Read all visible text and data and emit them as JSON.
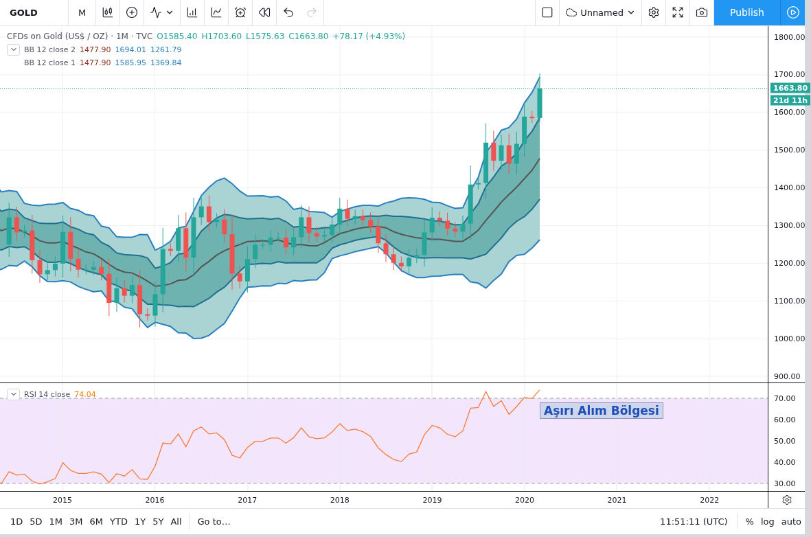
{
  "toolbar": {
    "symbol": "GOLD",
    "interval": "M",
    "redo": {
      "disabled": true
    },
    "layout_name": "Unnamed",
    "publish": "Publish"
  },
  "legend": {
    "title": "CFDs on Gold (US$ / OZ) · 1M · TVC",
    "ohlc": [
      "O1585.40",
      "H1703.60",
      "L1575.63",
      "C1663.80",
      "+78.17 (+4.93%)"
    ],
    "indicators": [
      {
        "label": "BB 12 close 2",
        "values": [
          "1477.90",
          "1694.01",
          "1261.79"
        ],
        "collapse_button": true
      },
      {
        "label": "BB 12 close 1",
        "values": [
          "1477.90",
          "1585.95",
          "1369.84"
        ],
        "collapse_button": false
      }
    ]
  },
  "price_axis": {
    "labels": [
      "1800.00",
      "1700.00",
      "1600.00",
      "1500.00",
      "1400.00",
      "1300.00",
      "1200.00",
      "1100.00",
      "1000.00",
      "900.00"
    ],
    "last_price": "1663.80",
    "countdown": "21d 11h"
  },
  "rsi": {
    "label": "RSI 14 close",
    "value": "74.04",
    "annotation": "Aşırı Alım Bölgesi",
    "axis_labels": [
      "70.00",
      "60.00",
      "50.00",
      "40.00",
      "30.00"
    ]
  },
  "time_axis": [
    "2015",
    "2016",
    "2017",
    "2018",
    "2019",
    "2020",
    "2021",
    "2022"
  ],
  "bottom_bar": {
    "ranges": [
      "1D",
      "5D",
      "1M",
      "3M",
      "6M",
      "YTD",
      "1Y",
      "5Y",
      "All"
    ],
    "goto": "Go to…",
    "clock": "11:51:11 (UTC)",
    "scale_options": [
      "%",
      "log",
      "auto"
    ]
  }
}
